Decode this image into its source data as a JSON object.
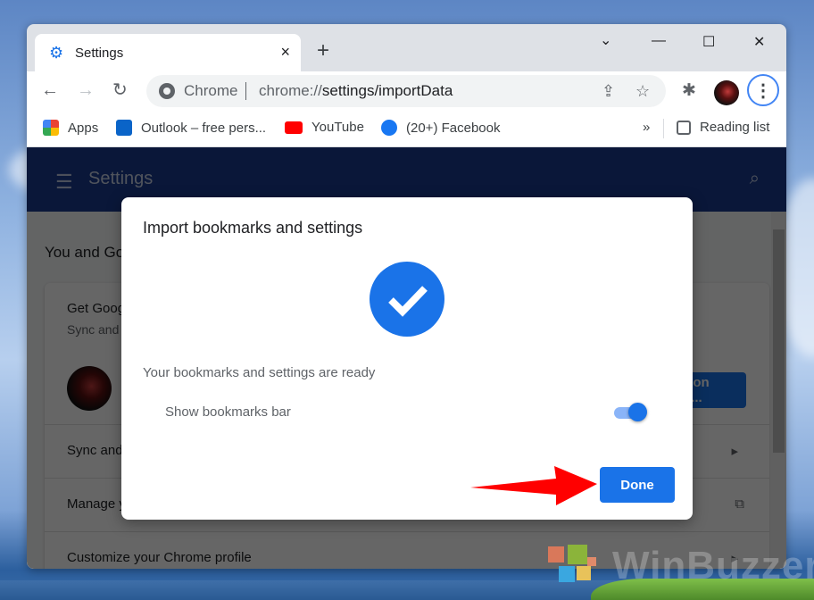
{
  "browser": {
    "tab": {
      "title": "Settings",
      "icon": "gear-icon",
      "close": "×"
    },
    "new_tab": "+",
    "window_controls": {
      "tab_search": "⌄",
      "minimize": "—",
      "maximize": "☐",
      "close": "✕"
    },
    "nav": {
      "back": "←",
      "forward": "→",
      "reload": "↻"
    },
    "omnibox": {
      "chip": "Chrome",
      "url_host": "chrome://",
      "url_path": "settings/importData"
    },
    "bookmarks_bar": {
      "items": [
        {
          "label": "Apps",
          "icon": "apps-grid-icon"
        },
        {
          "label": "Outlook – free pers...",
          "icon": "outlook-icon"
        },
        {
          "label": "YouTube",
          "icon": "youtube-icon"
        },
        {
          "label": "(20+) Facebook",
          "icon": "facebook-icon"
        }
      ],
      "overflow": "»",
      "reading_list": "Reading list"
    }
  },
  "settings": {
    "header_title": "Settings",
    "section_title": "You and Google",
    "rows": [
      "Get Google smarts in Chrome",
      "Sync and Google services",
      "Manage your Google Account",
      "Customize your Chrome profile"
    ],
    "row_subtitle": "Sync and personalize Chrome across your devices",
    "sync_button": "Turn on sync..."
  },
  "dialog": {
    "title": "Import bookmarks and settings",
    "status": "Your bookmarks and settings are ready",
    "toggle_label": "Show bookmarks bar",
    "toggle_on": true,
    "done_label": "Done"
  },
  "annotation": {
    "arrow_color": "#ff0000"
  },
  "watermark": "WinBuzzer",
  "colors": {
    "accent": "#1a73e8",
    "header": "#1a3a8f"
  }
}
